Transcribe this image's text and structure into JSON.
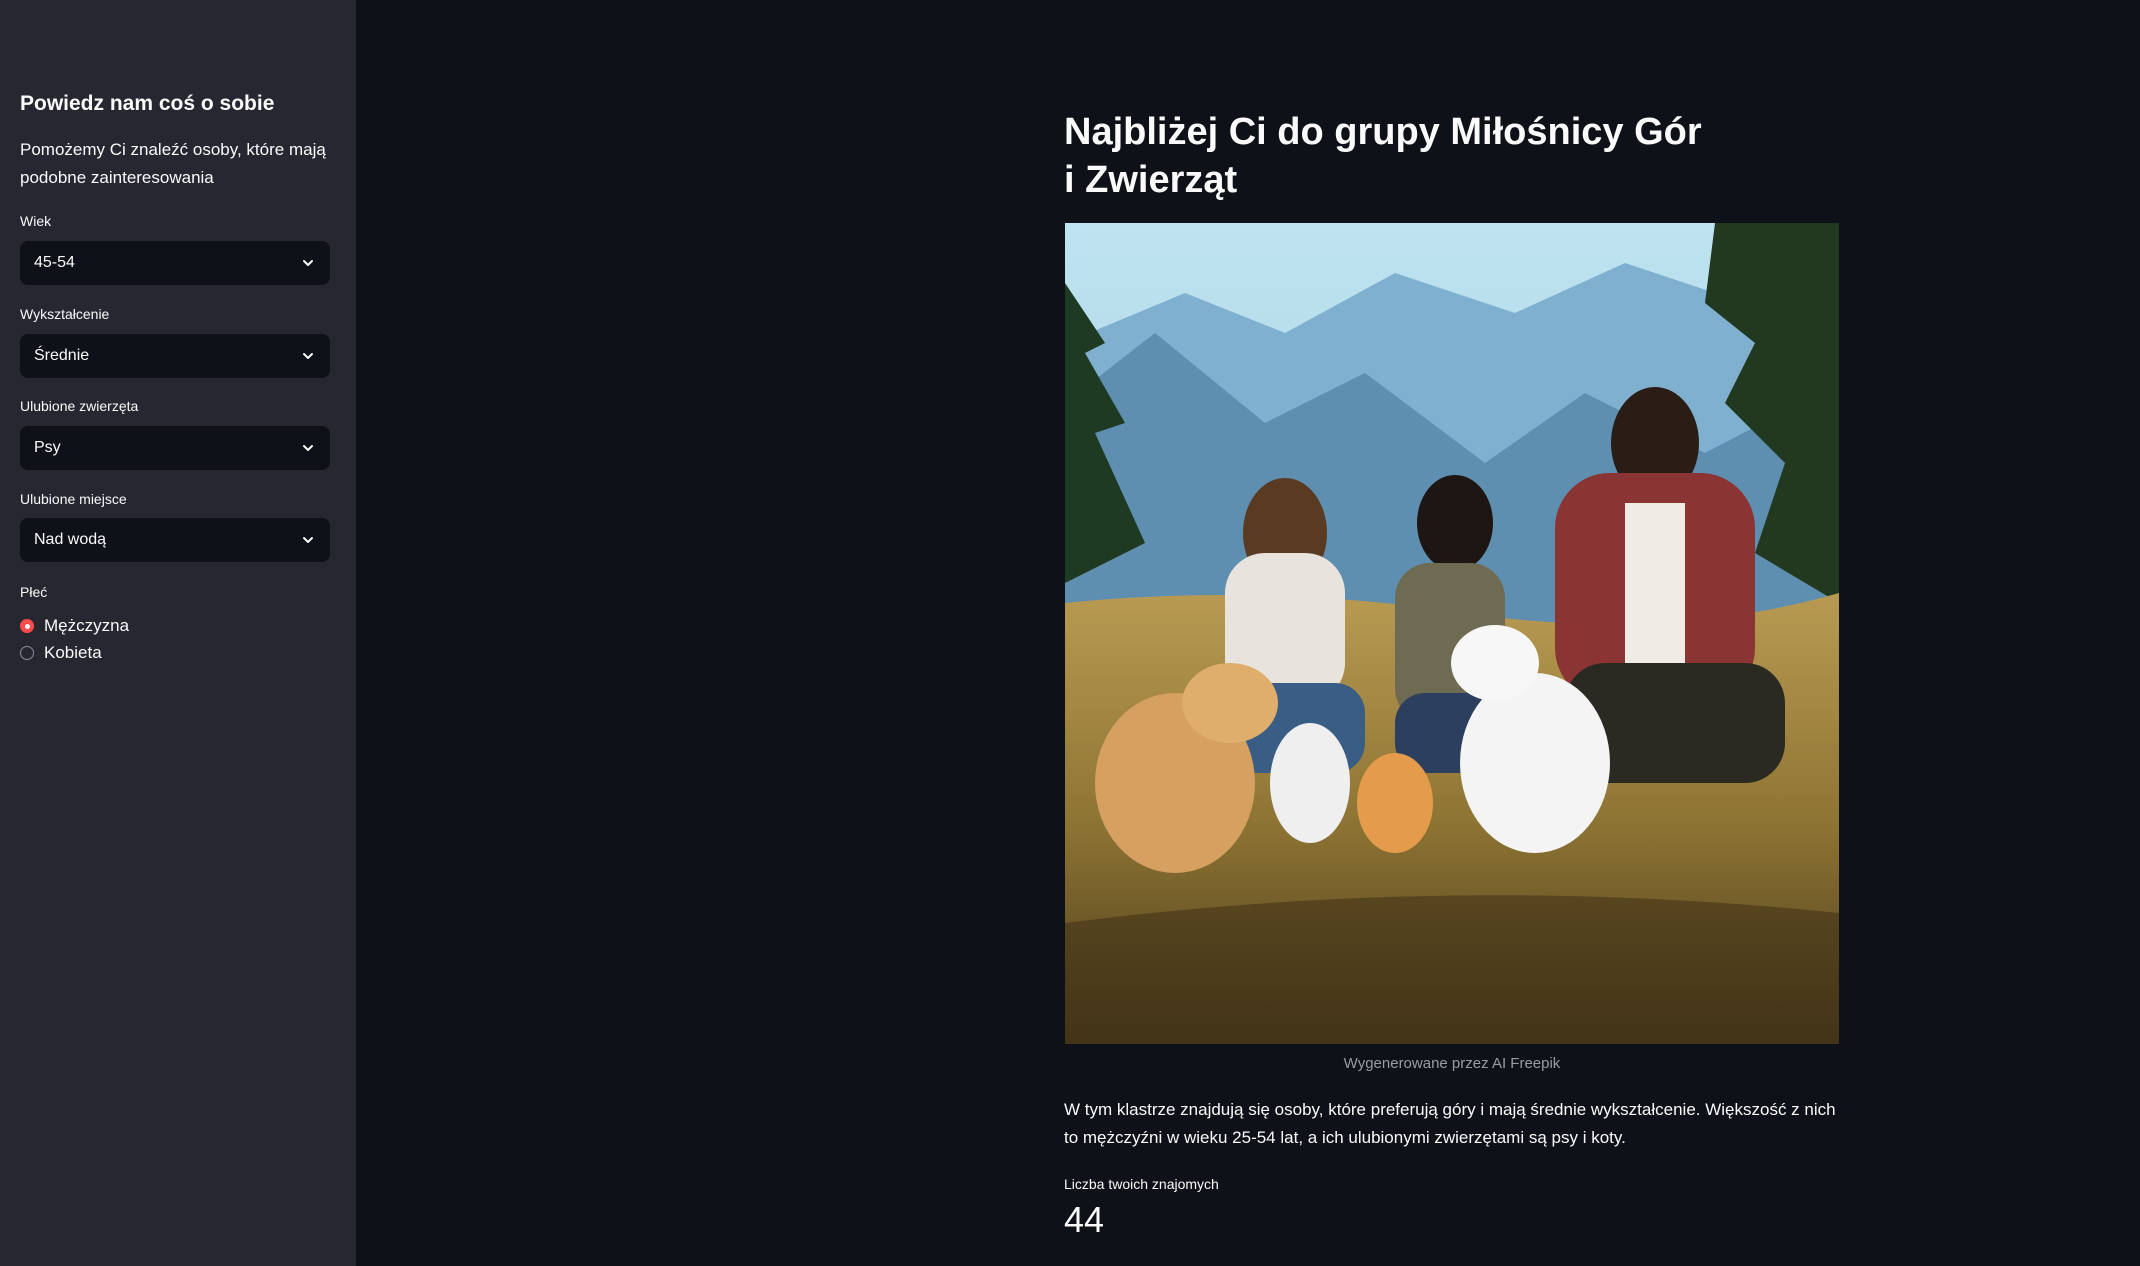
{
  "sidebar": {
    "title": "Powiedz nam coś o sobie",
    "description": "Pomożemy Ci znaleźć osoby, które mają podobne zainteresowania",
    "fields": {
      "age": {
        "label": "Wiek",
        "value": "45-54"
      },
      "education": {
        "label": "Wykształcenie",
        "value": "Średnie"
      },
      "animals": {
        "label": "Ulubione zwierzęta",
        "value": "Psy"
      },
      "place": {
        "label": "Ulubione miejsce",
        "value": "Nad wodą"
      }
    },
    "gender": {
      "label": "Płeć",
      "options": [
        "Mężczyzna",
        "Kobieta"
      ],
      "selected": "Mężczyzna"
    }
  },
  "main": {
    "title": "Najbliżej Ci do grupy Miłośnicy Gór i Zwierząt",
    "image_caption": "Wygenerowane przez AI Freepik",
    "description": "W tym klastrze znajdują się osoby, które preferują góry i mają średnie wykształcenie. Większość z nich to mężczyźni w wieku 25-54 lat, a ich ulubionymi zwierzętami są psy i koty.",
    "metric": {
      "label": "Liczba twoich znajomych",
      "value": "44"
    }
  },
  "colors": {
    "background": "#0e1117",
    "sidebar": "#262730",
    "accent": "#ff4b4b"
  }
}
